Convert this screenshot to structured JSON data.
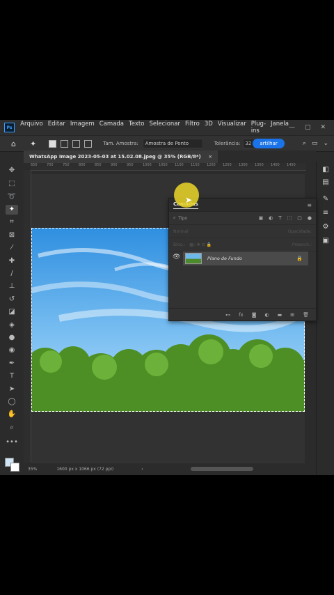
{
  "menubar": {
    "app_logo": "Ps",
    "items": [
      "Arquivo",
      "Editar",
      "Imagem",
      "Camada",
      "Texto",
      "Selecionar",
      "Filtro",
      "3D",
      "Visualizar",
      "Plug-ins",
      "Janela"
    ],
    "window_controls": [
      "—",
      "▢",
      "✕"
    ]
  },
  "options": {
    "sample_size_label": "Tam. Amostra:",
    "sample_size_value": "Amostra de Ponto",
    "tolerance_label": "Tolerância:",
    "tolerance_value": "32",
    "share_label": "artilhar"
  },
  "document": {
    "tab_title": "WhatsApp Image 2023-05-03 at 15.02.08.jpeg @ 35% (RGB/8*)",
    "tab_close": "×",
    "ruler_ticks": [
      "650",
      "700",
      "750",
      "800",
      "850",
      "900",
      "950",
      "1000",
      "1050",
      "1100",
      "1150",
      "1200",
      "1250",
      "1300",
      "1350",
      "1400",
      "1450"
    ]
  },
  "layers_panel": {
    "title": "Camadas",
    "search_placeholder": "Tipo",
    "blend_mode": "Normal",
    "opacity_label": "Opacidade:",
    "lock_label": "Bloq.:",
    "fill_label": "Preench.:",
    "layer_name": "Plano de Fundo"
  },
  "status": {
    "zoom": "35%",
    "dimensions": "1600 px x 1066 px (72 ppi)",
    "arrow": "›"
  },
  "colors": {
    "foreground": "#cfe4f5",
    "background": "#ffffff",
    "share_accent": "#1a73e8",
    "cursor_highlight": "#ebd728"
  }
}
